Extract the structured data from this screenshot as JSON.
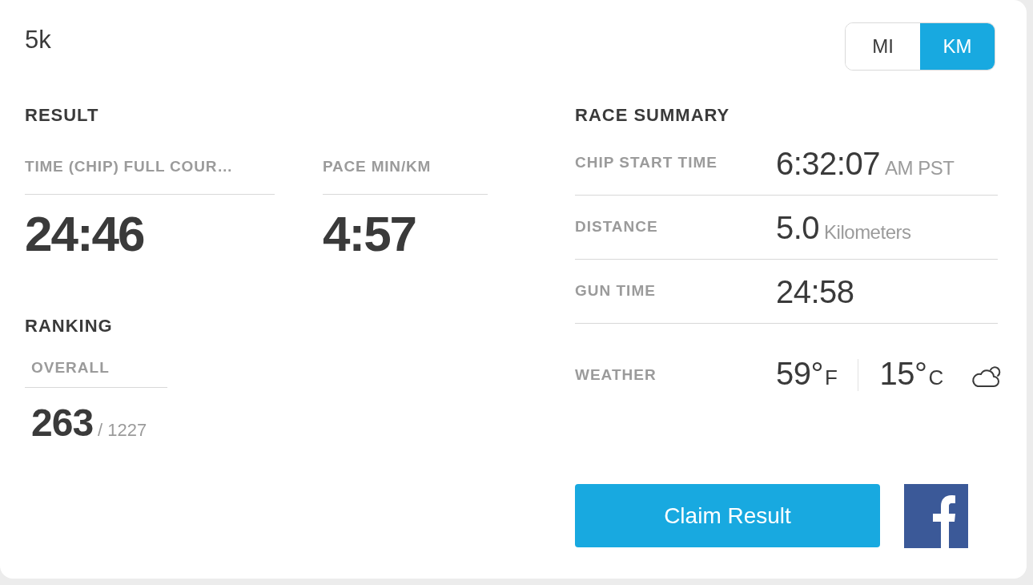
{
  "event": {
    "title": "5k"
  },
  "unit_toggle": [
    {
      "label": "MI",
      "selected": false
    },
    {
      "label": "KM",
      "selected": true
    }
  ],
  "result": {
    "heading": "RESULT",
    "metrics": [
      {
        "label": "TIME (CHIP) FULL COUR…",
        "value": "24:46"
      },
      {
        "label": "PACE MIN/KM",
        "value": "4:57"
      }
    ]
  },
  "ranking": {
    "heading": "RANKING",
    "items": [
      {
        "label": "OVERALL",
        "value": "263",
        "total": "/ 1227"
      }
    ]
  },
  "race_summary": {
    "heading": "RACE SUMMARY",
    "rows": [
      {
        "kind": "value",
        "label": "CHIP START TIME",
        "value": "6:32:07",
        "unit": "AM PST"
      },
      {
        "kind": "value",
        "label": "DISTANCE",
        "value": "5.0",
        "unit": "Kilometers"
      },
      {
        "kind": "value",
        "label": "GUN TIME",
        "value": "24:58"
      },
      {
        "kind": "weather",
        "label": "WEATHER",
        "temps": [
          {
            "value": "59°",
            "unit": "F"
          },
          {
            "value": "15°",
            "unit": "C"
          }
        ]
      }
    ]
  },
  "actions": {
    "claim_button": "Claim Result"
  }
}
